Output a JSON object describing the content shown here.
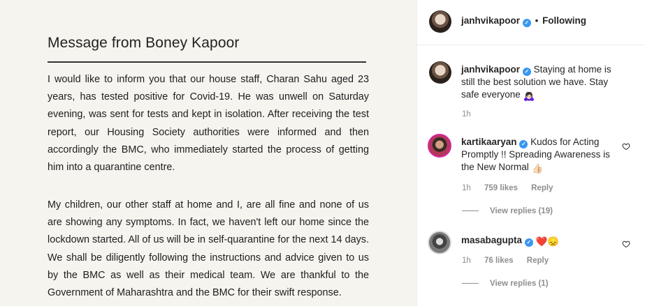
{
  "post": {
    "title": "Message from Boney Kapoor",
    "paragraph1": "I would like to inform you that our house staff, Charan Sahu aged 23 years, has tested positive for Covid-19. He was unwell on Saturday evening, was sent for tests and kept in isolation. After receiving the test report, our Housing Society authorities were informed and then accordingly the BMC, who immediately started the process of getting him into a quarantine centre.",
    "paragraph2": "My children, our other staff at home and I, are all fine and none of us are showing any symptoms. In fact, we haven't left our home since the lockdown started. All of us will be in self-quarantine for the next 14 days. We shall be diligently following the instructions and advice given to us by the BMC as well as their medical team. We are thankful to the Government of Maharashtra and the BMC for their swift response."
  },
  "header": {
    "username": "janhvikapoor",
    "separator": "•",
    "follow_status": "Following"
  },
  "caption": {
    "username": "janhvikapoor",
    "text": "Staying at home is still the best solution we have. Stay safe everyone",
    "emoji": "🙇🏻‍♀️",
    "time": "1h"
  },
  "comments": [
    {
      "username": "kartikaaryan",
      "text": "Kudos for Acting Promptly !! Spreading Awareness is the New Normal",
      "emoji": "👍🏻",
      "time": "1h",
      "likes": "759 likes",
      "reply": "Reply",
      "view_replies": "View replies (19)"
    },
    {
      "username": "masabagupta",
      "text": "",
      "emoji": "❤️😞",
      "time": "1h",
      "likes": "76 likes",
      "reply": "Reply",
      "view_replies": "View replies (1)"
    }
  ],
  "icons": {
    "verified": "verified-badge-icon",
    "like": "heart-outline-icon"
  },
  "colors": {
    "verified_blue": "#3897f0",
    "meta_gray": "#8e8e8e",
    "image_bg": "#f6f4ef"
  }
}
